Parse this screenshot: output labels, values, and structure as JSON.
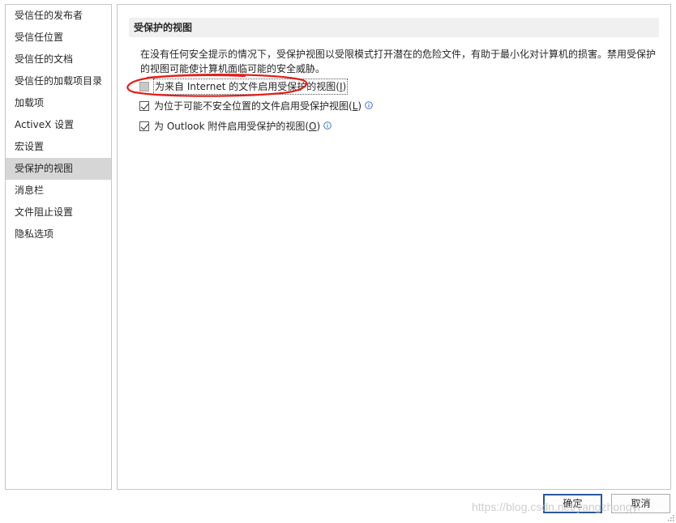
{
  "sidebar": {
    "items": [
      {
        "label": "受信任的发布者"
      },
      {
        "label": "受信任位置"
      },
      {
        "label": "受信任的文档"
      },
      {
        "label": "受信任的加载项目录"
      },
      {
        "label": "加载项"
      },
      {
        "label": "ActiveX 设置"
      },
      {
        "label": "宏设置"
      },
      {
        "label": "受保护的视图",
        "selected": true
      },
      {
        "label": "消息栏"
      },
      {
        "label": "文件阻止设置"
      },
      {
        "label": "隐私选项"
      }
    ]
  },
  "main": {
    "section_title": "受保护的视图",
    "description": "在没有任何安全提示的情况下，受保护视图以受限模式打开潜在的危险文件，有助于最小化对计算机的损害。禁用受保护的视图可能使计算机面临可能的安全威胁。",
    "options": [
      {
        "label": "为来自 Internet 的文件启用受保护的视图",
        "mnemonic": "I",
        "checked": false,
        "info_icon": false
      },
      {
        "label": "为位于可能不安全位置的文件启用受保护视图",
        "mnemonic": "L",
        "checked": true,
        "info_icon": true
      },
      {
        "label": "为 Outlook 附件启用受保护的视图",
        "mnemonic": "O",
        "checked": true,
        "info_icon": true
      }
    ]
  },
  "buttons": {
    "ok": "确定",
    "cancel": "取消"
  },
  "watermark": "https://blog.csdn.net/yangzhongyi",
  "icons": {
    "info": "info-icon",
    "check": "checkmark-icon",
    "resize": "resize-grip-icon"
  },
  "colors": {
    "annotation": "#e0201b",
    "selected_bg": "#d6d6d6",
    "ok_border": "#2b579a",
    "info": "#2b6cc4"
  }
}
